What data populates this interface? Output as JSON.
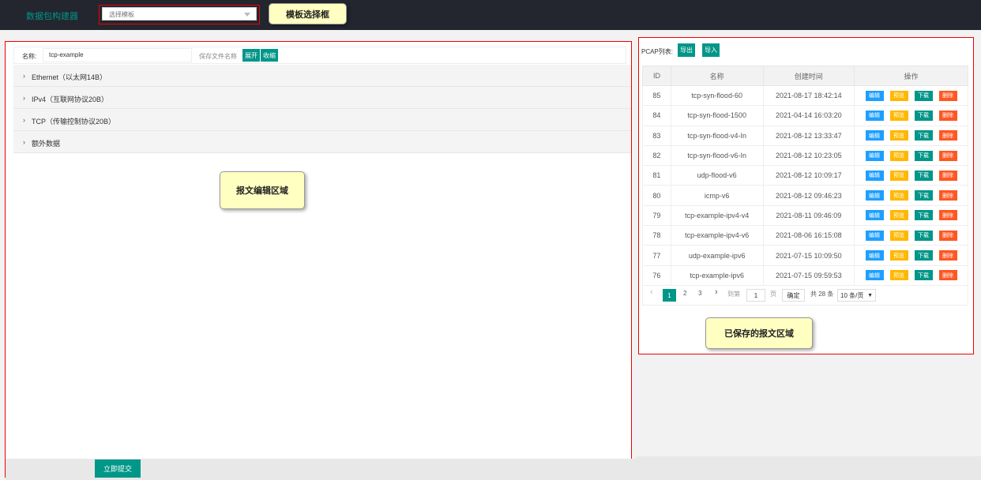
{
  "header": {
    "brand": "数据包构建器",
    "template_select": {
      "placeholder": "选择模板"
    }
  },
  "callouts": {
    "template": "模板选择框",
    "editor": "报文编辑区域",
    "saved": "已保存的报文区域"
  },
  "editor": {
    "name_label": "名称:",
    "name_value": "tcp-example",
    "save_hint": "保存文件名称",
    "expand_label": "展开",
    "collapse_label": "收缩",
    "sections": [
      {
        "title": "Ethernet（以太网14B）"
      },
      {
        "title": "IPv4（互联网协议20B）"
      },
      {
        "title": "TCP（传输控制协议20B）"
      },
      {
        "title": "额外数据"
      }
    ],
    "submit_label": "立即提交"
  },
  "pcap": {
    "label": "PCAP列表:",
    "export_label": "导出",
    "import_label": "导入",
    "columns": [
      "ID",
      "名称",
      "创建时间",
      "操作"
    ],
    "actions": {
      "edit": "编辑",
      "preview": "预览",
      "download": "下载",
      "delete": "删除"
    },
    "rows": [
      {
        "id": "85",
        "name": "tcp-syn-flood-60",
        "created": "2021-08-17 18:42:14"
      },
      {
        "id": "84",
        "name": "tcp-syn-flood-1500",
        "created": "2021-04-14 16:03:20"
      },
      {
        "id": "83",
        "name": "tcp-syn-flood-v4-In",
        "created": "2021-08-12 13:33:47"
      },
      {
        "id": "82",
        "name": "tcp-syn-flood-v6-In",
        "created": "2021-08-12 10:23:05"
      },
      {
        "id": "81",
        "name": "udp-flood-v6",
        "created": "2021-08-12 10:09:17"
      },
      {
        "id": "80",
        "name": "icmp-v6",
        "created": "2021-08-12 09:46:23"
      },
      {
        "id": "79",
        "name": "tcp-example-ipv4-v4",
        "created": "2021-08-11 09:46:09"
      },
      {
        "id": "78",
        "name": "tcp-example-ipv4-v6",
        "created": "2021-08-06 16:15:08"
      },
      {
        "id": "77",
        "name": "udp-example-ipv6",
        "created": "2021-07-15 10:09:50"
      },
      {
        "id": "76",
        "name": "tcp-example-ipv6",
        "created": "2021-07-15 09:59:53"
      }
    ],
    "pagination": {
      "prev": "‹",
      "pages": [
        "1",
        "2",
        "3"
      ],
      "next": "›",
      "goto_label": "到第",
      "goto_value": "1",
      "page_unit": "页",
      "confirm_label": "确定",
      "total_label": "共 28 条",
      "page_size": "10 条/页"
    }
  },
  "colors": {
    "accent": "#009688",
    "edit": "#1e9fff",
    "preview": "#ffb800",
    "download": "#009688",
    "delete": "#ff5722",
    "header_bg": "#23262e"
  }
}
